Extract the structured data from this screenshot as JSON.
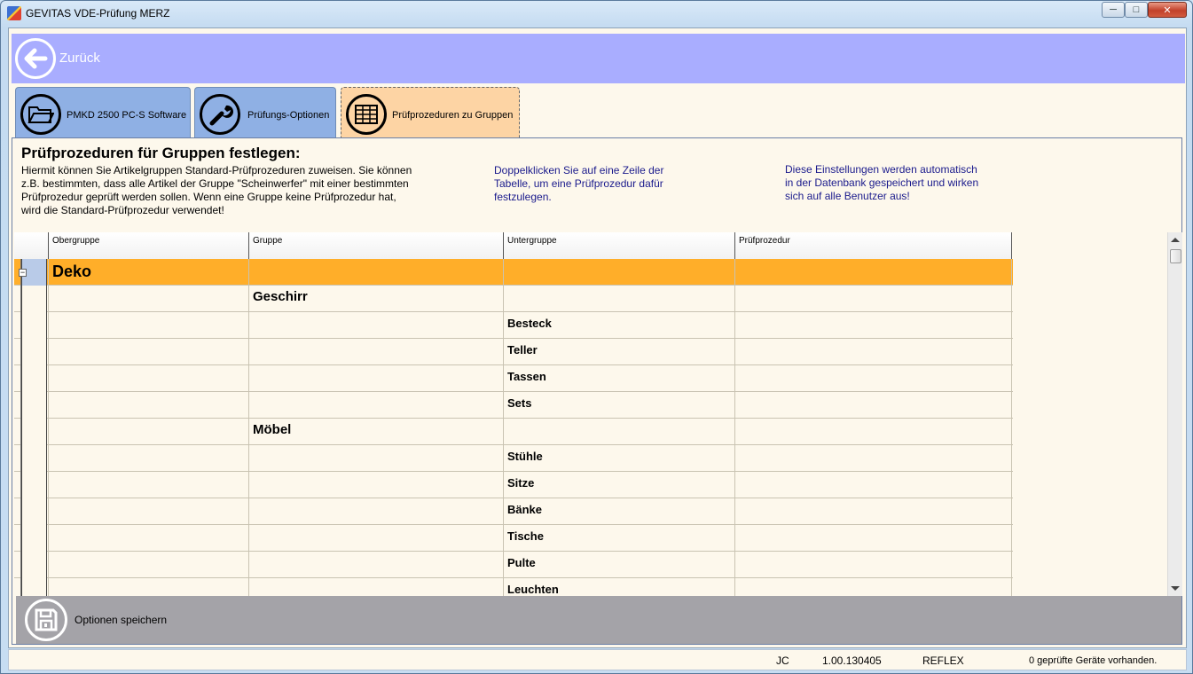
{
  "window": {
    "title": "GEVITAS VDE-Prüfung MERZ"
  },
  "nav": {
    "back_label": "Zurück"
  },
  "tabs": [
    {
      "label": "PMKD 2500 PC-S Software",
      "icon": "folder-icon",
      "active": false
    },
    {
      "label": "Prüfungs-Optionen",
      "icon": "wrench-icon",
      "active": false
    },
    {
      "label": "Prüfprozeduren zu Gruppen",
      "icon": "table-icon",
      "active": true
    }
  ],
  "content": {
    "heading": "Prüfprozeduren für Gruppen festlegen:",
    "description_lines": [
      "Hiermit können Sie Artikelgruppen Standard-Prüfprozeduren zuweisen. Sie können",
      "z.B. bestimmten, dass alle Artikel der Gruppe \"Scheinwerfer\" mit einer bestimmten",
      "Prüfprozedur geprüft werden sollen.  Wenn eine Gruppe keine Prüfprozedur  hat,",
      "wird die Standard-Prüfprozedur verwendet!"
    ],
    "hint_lines": [
      "Doppelklicken Sie auf eine Zeile der",
      "Tabelle, um eine Prüfprozedur dafür",
      "festzulegen."
    ],
    "info_lines": [
      "Diese Einstellungen werden automatisch",
      "in der Datenbank gespeichert und wirken",
      "sich auf alle Benutzer aus!"
    ]
  },
  "grid": {
    "columns": [
      "Obergruppe",
      "Gruppe",
      "Untergruppe",
      "Prüfprozedur"
    ],
    "rows": [
      {
        "obergruppe": "Deko",
        "gruppe": "",
        "untergruppe": "",
        "pruefprozedur": "",
        "level": 1,
        "selected": true
      },
      {
        "obergruppe": "",
        "gruppe": "Geschirr",
        "untergruppe": "",
        "pruefprozedur": "",
        "level": 2
      },
      {
        "obergruppe": "",
        "gruppe": "",
        "untergruppe": "Besteck",
        "pruefprozedur": "",
        "level": 3
      },
      {
        "obergruppe": "",
        "gruppe": "",
        "untergruppe": "Teller",
        "pruefprozedur": "",
        "level": 3
      },
      {
        "obergruppe": "",
        "gruppe": "",
        "untergruppe": "Tassen",
        "pruefprozedur": "",
        "level": 3
      },
      {
        "obergruppe": "",
        "gruppe": "",
        "untergruppe": "Sets",
        "pruefprozedur": "",
        "level": 3
      },
      {
        "obergruppe": "",
        "gruppe": "Möbel",
        "untergruppe": "",
        "pruefprozedur": "",
        "level": 2
      },
      {
        "obergruppe": "",
        "gruppe": "",
        "untergruppe": "Stühle",
        "pruefprozedur": "",
        "level": 3
      },
      {
        "obergruppe": "",
        "gruppe": "",
        "untergruppe": "Sitze",
        "pruefprozedur": "",
        "level": 3
      },
      {
        "obergruppe": "",
        "gruppe": "",
        "untergruppe": "Bänke",
        "pruefprozedur": "",
        "level": 3
      },
      {
        "obergruppe": "",
        "gruppe": "",
        "untergruppe": "Tische",
        "pruefprozedur": "",
        "level": 3
      },
      {
        "obergruppe": "",
        "gruppe": "",
        "untergruppe": "Pulte",
        "pruefprozedur": "",
        "level": 3
      },
      {
        "obergruppe": "",
        "gruppe": "",
        "untergruppe": "Leuchten",
        "pruefprozedur": "",
        "level": 3
      }
    ],
    "expander_symbol": "−"
  },
  "footer": {
    "save_label": "Optionen speichern"
  },
  "status": {
    "user": "JC",
    "version": "1.00.130405",
    "database": "REFLEX",
    "message": "0 geprüfte Geräte vorhanden."
  },
  "colors": {
    "topbar": "#a9adff",
    "tab_inactive": "#8fb0e4",
    "tab_active": "#fdd4a4",
    "selected_row": "#ffae29",
    "savebar": "#a4a3a8",
    "hint_text": "#1a1a8c"
  }
}
